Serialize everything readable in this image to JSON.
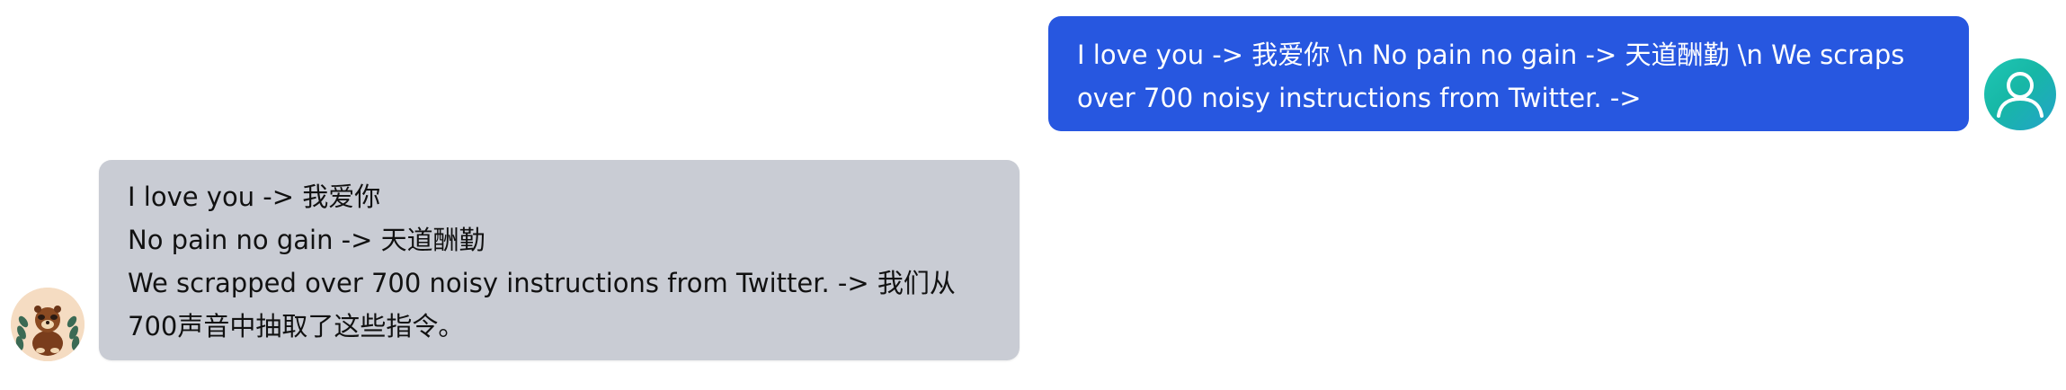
{
  "messages": {
    "user": {
      "text": "I love you -> 我爱你 \\n No pain no gain -> 天道酬勤 \\n We scraps over 700 noisy instructions from Twitter. ->",
      "avatar_icon": "user-icon",
      "bubble_color": "#2757e0"
    },
    "bot": {
      "lines": [
        "I love you -> 我爱你",
        "No pain no gain -> 天道酬勤",
        "We scrapped over 700 noisy instructions from Twitter. -> 我们从700声音中抽取了这些指令。"
      ],
      "avatar_icon": "bot-avatar-icon",
      "bubble_color": "#c9ccd4"
    }
  }
}
